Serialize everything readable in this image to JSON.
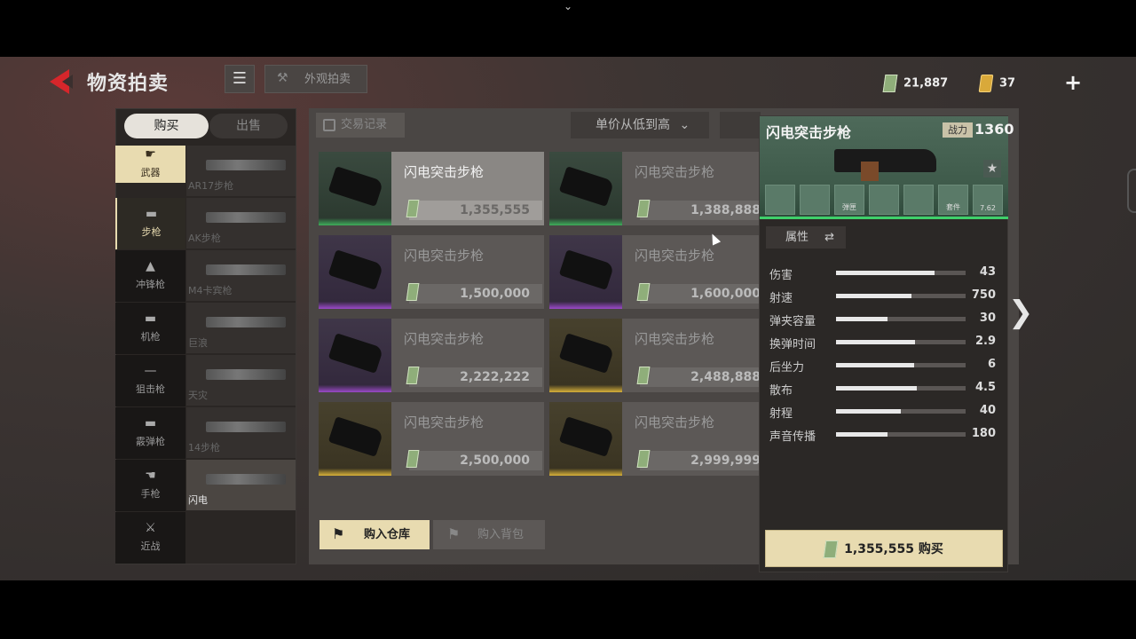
{
  "header": {
    "title": "物资拍卖",
    "look_auction_label": "外观拍卖",
    "currency_bills": "21,887",
    "currency_gold": "37",
    "add_label": "+"
  },
  "tabs": {
    "buy": "购买",
    "sell": "出售"
  },
  "categories": [
    {
      "label": "武器",
      "icon": "weapon-icon"
    },
    {
      "label": "步枪",
      "icon": "rifle-icon"
    },
    {
      "label": "冲锋枪",
      "icon": "smg-icon"
    },
    {
      "label": "机枪",
      "icon": "machinegun-icon"
    },
    {
      "label": "狙击枪",
      "icon": "sniper-icon"
    },
    {
      "label": "霰弹枪",
      "icon": "shotgun-icon"
    },
    {
      "label": "手枪",
      "icon": "pistol-icon"
    },
    {
      "label": "近战",
      "icon": "melee-icon"
    }
  ],
  "subcategories": [
    {
      "label": "AR17步枪"
    },
    {
      "label": "AK步枪"
    },
    {
      "label": "M4卡宾枪"
    },
    {
      "label": "巨浪"
    },
    {
      "label": "天灾"
    },
    {
      "label": "14步枪"
    },
    {
      "label": "闪电"
    }
  ],
  "toolbar": {
    "records_label": "交易记录",
    "sort_label": "单价从低到高"
  },
  "listings": [
    {
      "name": "闪电突击步枪",
      "price": "1,355,555",
      "rarity": "green"
    },
    {
      "name": "闪电突击步枪",
      "price": "1,388,888",
      "rarity": "green"
    },
    {
      "name": "闪电突击步枪",
      "price": "1,500,000",
      "rarity": "purple"
    },
    {
      "name": "闪电突击步枪",
      "price": "1,600,000",
      "rarity": "purple"
    },
    {
      "name": "闪电突击步枪",
      "price": "2,222,222",
      "rarity": "purple"
    },
    {
      "name": "闪电突击步枪",
      "price": "2,488,888",
      "rarity": "gold"
    },
    {
      "name": "闪电突击步枪",
      "price": "2,500,000",
      "rarity": "gold"
    },
    {
      "name": "闪电突击步枪",
      "price": "2,999,999",
      "rarity": "gold"
    }
  ],
  "bottom": {
    "to_warehouse": "购入仓库",
    "to_backpack": "购入背包"
  },
  "detail": {
    "name": "闪电突击步枪",
    "power_label": "战力",
    "power": "1360",
    "slot_labels": [
      "",
      "",
      "弹匣",
      "",
      "",
      "套件",
      "7.62"
    ],
    "attr_label": "属性",
    "stats": [
      {
        "label": "伤害",
        "value": "43",
        "fill": 0.76
      },
      {
        "label": "射速",
        "value": "750",
        "fill": 0.58
      },
      {
        "label": "弹夹容量",
        "value": "30",
        "fill": 0.4
      },
      {
        "label": "换弹时间",
        "value": "2.9",
        "fill": 0.61
      },
      {
        "label": "后坐力",
        "value": "6",
        "fill": 0.6
      },
      {
        "label": "散布",
        "value": "4.5",
        "fill": 0.62
      },
      {
        "label": "射程",
        "value": "40",
        "fill": 0.5
      },
      {
        "label": "声音传播",
        "value": "180",
        "fill": 0.4
      }
    ],
    "buy_price": "1,355,555",
    "buy_label": "购买"
  },
  "colors": {
    "accent": "#e8dbb0",
    "back_arrow": "#d6262b",
    "rarity_green": "#3fae5b",
    "rarity_purple": "#9b4ac9",
    "rarity_gold": "#d9b23a"
  }
}
